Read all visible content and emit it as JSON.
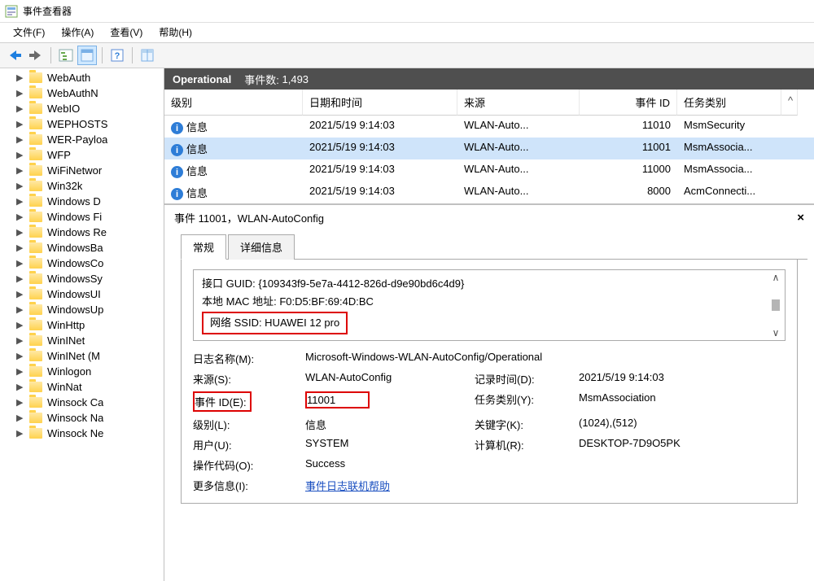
{
  "window": {
    "title": "事件查看器"
  },
  "menu": {
    "file": "文件(F)",
    "action": "操作(A)",
    "view": "查看(V)",
    "help": "帮助(H)"
  },
  "tree": {
    "items": [
      "WebAuth",
      "WebAuthN",
      "WebIO",
      "WEPHOSTS",
      "WER-Payloa",
      "WFP",
      "WiFiNetwor",
      "Win32k",
      "Windows D",
      "Windows Fi",
      "Windows Re",
      "WindowsBa",
      "WindowsCo",
      "WindowsSy",
      "WindowsUI",
      "WindowsUp",
      "WinHttp",
      "WinINet",
      "WinINet (M",
      "Winlogon",
      "WinNat",
      "Winsock Ca",
      "Winsock Na",
      "Winsock Ne"
    ]
  },
  "header": {
    "title": "Operational",
    "count_label": "事件数:",
    "count": "1,493"
  },
  "cols": {
    "level": "级别",
    "datetime": "日期和时间",
    "source": "来源",
    "event_id": "事件 ID",
    "category": "任务类别"
  },
  "events": [
    {
      "level": "信息",
      "datetime": "2021/5/19 9:14:03",
      "source": "WLAN-Auto...",
      "id": "11010",
      "cat": "MsmSecurity"
    },
    {
      "level": "信息",
      "datetime": "2021/5/19 9:14:03",
      "source": "WLAN-Auto...",
      "id": "11001",
      "cat": "MsmAssocia..."
    },
    {
      "level": "信息",
      "datetime": "2021/5/19 9:14:03",
      "source": "WLAN-Auto...",
      "id": "11000",
      "cat": "MsmAssocia..."
    },
    {
      "level": "信息",
      "datetime": "2021/5/19 9:14:03",
      "source": "WLAN-Auto...",
      "id": "8000",
      "cat": "AcmConnecti..."
    }
  ],
  "detail": {
    "title": "事件 11001，WLAN-AutoConfig",
    "tabs": {
      "general": "常规",
      "details": "详细信息"
    },
    "desc": {
      "line1": "接口 GUID: {109343f9-5e7a-4412-826d-d9e90bd6c4d9}",
      "line2": "本地 MAC 地址: F0:D5:BF:69:4D:BC",
      "line3": "网络 SSID: HUAWEI 12 pro"
    },
    "labels": {
      "log_name": "日志名称(M):",
      "source": "来源(S):",
      "event_id": "事件 ID(E):",
      "level": "级别(L):",
      "user": "用户(U):",
      "opcode": "操作代码(O):",
      "more": "更多信息(I):",
      "logged": "记录时间(D):",
      "category": "任务类别(Y):",
      "keywords": "关键字(K):",
      "computer": "计算机(R):"
    },
    "values": {
      "log_name": "Microsoft-Windows-WLAN-AutoConfig/Operational",
      "source": "WLAN-AutoConfig",
      "event_id": "11001",
      "level": "信息",
      "user": "SYSTEM",
      "opcode": "Success",
      "more_link": "事件日志联机帮助",
      "logged": "2021/5/19 9:14:03",
      "category": "MsmAssociation",
      "keywords": "(1024),(512)",
      "computer": "DESKTOP-7D9O5PK"
    }
  }
}
